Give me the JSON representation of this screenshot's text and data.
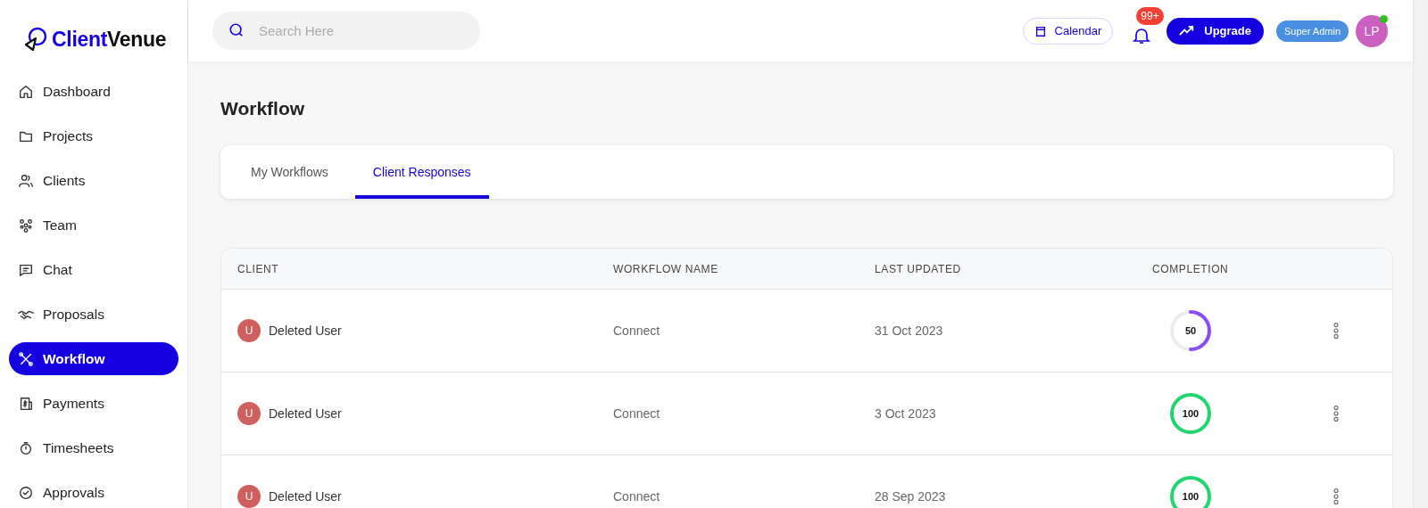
{
  "brand": {
    "name_part_1": "Client",
    "name_part_2": "Venue"
  },
  "sidebar": {
    "items": [
      {
        "label": "Dashboard",
        "selected": false
      },
      {
        "label": "Projects",
        "selected": false
      },
      {
        "label": "Clients",
        "selected": false
      },
      {
        "label": "Team",
        "selected": false
      },
      {
        "label": "Chat",
        "selected": false
      },
      {
        "label": "Proposals",
        "selected": false
      },
      {
        "label": "Workflow",
        "selected": true
      },
      {
        "label": "Payments",
        "selected": false
      },
      {
        "label": "Timesheets",
        "selected": false
      },
      {
        "label": "Approvals",
        "selected": false
      }
    ]
  },
  "header": {
    "search": {
      "placeholder": "Search Here"
    },
    "calendar": "Calendar",
    "notifications_badge": "99+",
    "upgrade": "Upgrade",
    "role": "Super Admin",
    "avatar": "LP",
    "online": true
  },
  "page_title": "Workflow",
  "tabs": [
    {
      "label": "My Workflows",
      "selected": false
    },
    {
      "label": "Client Responses",
      "selected": true
    }
  ],
  "table": {
    "columns": [
      "CLIENT",
      "WORKFLOW NAME",
      "LAST UPDATED",
      "COMPLETION"
    ],
    "rows": [
      {
        "initial": "U",
        "client": "Deleted User",
        "workflow": "Connect",
        "last_updated": "31 Oct 2023",
        "completion": "50",
        "level": 0.5,
        "color": "#8b4cf7"
      },
      {
        "initial": "U",
        "client": "Deleted User",
        "workflow": "Connect",
        "last_updated": "3 Oct 2023",
        "completion": "100",
        "level": 1,
        "color": "#1fd66f"
      },
      {
        "initial": "U",
        "client": "Deleted User",
        "workflow": "Connect",
        "last_updated": "28 Sep 2023",
        "completion": "100",
        "level": 1,
        "color": "#1fd66f"
      }
    ]
  }
}
